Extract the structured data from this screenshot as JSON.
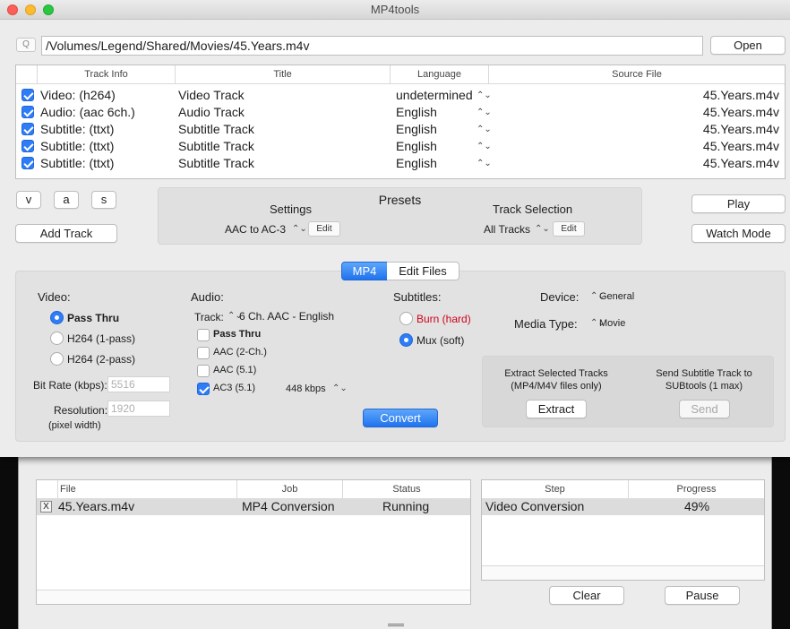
{
  "window": {
    "title": "MP4tools"
  },
  "colors": {
    "accent": "#2e7cf6",
    "burn_red": "#d0021b"
  },
  "file_bar": {
    "search_icon": "Q",
    "path": "/Volumes/Legend/Shared/Movies/45.Years.m4v",
    "open_label": "Open"
  },
  "tracks_table": {
    "headers": [
      "Track Info",
      "Title",
      "Language",
      "Source File"
    ],
    "rows": [
      {
        "checked": true,
        "info": "Video: (h264)",
        "title": "Video Track",
        "language": "undetermined",
        "source": "45.Years.m4v"
      },
      {
        "checked": true,
        "info": "Audio: (aac 6ch.)",
        "title": "Audio Track",
        "language": "English",
        "source": "45.Years.m4v"
      },
      {
        "checked": true,
        "info": "Subtitle: (ttxt)",
        "title": "Subtitle Track",
        "language": "English",
        "source": "45.Years.m4v"
      },
      {
        "checked": true,
        "info": "Subtitle: (ttxt)",
        "title": "Subtitle Track",
        "language": "English",
        "source": "45.Years.m4v"
      },
      {
        "checked": true,
        "info": "Subtitle: (ttxt)",
        "title": "Subtitle Track",
        "language": "English",
        "source": "45.Years.m4v"
      }
    ]
  },
  "track_buttons": {
    "v": "v",
    "a": "a",
    "s": "s",
    "add_track": "Add Track"
  },
  "presets": {
    "title": "Presets",
    "settings_label": "Settings",
    "settings_value": "AAC to AC-3",
    "track_selection_label": "Track Selection",
    "track_selection_value": "All Tracks",
    "edit_label": "Edit"
  },
  "play_label": "Play",
  "watch_mode_label": "Watch Mode",
  "tabs": {
    "mp4": "MP4",
    "edit_files": "Edit Files"
  },
  "video": {
    "label": "Video:",
    "options": [
      "Pass Thru",
      "H264 (1-pass)",
      "H264 (2-pass)"
    ],
    "selected": 0,
    "bitrate_label": "Bit Rate (kbps):",
    "bitrate_placeholder": "5516",
    "resolution_label": "Resolution:",
    "resolution_placeholder": "1920",
    "pixel_width_label": "(pixel width)"
  },
  "audio": {
    "label": "Audio:",
    "track_label": "Track:",
    "track_value": "6 Ch. AAC - English",
    "options": [
      {
        "label": "Pass Thru",
        "checked": false
      },
      {
        "label": "AAC (2-Ch.)",
        "checked": false
      },
      {
        "label": "AAC (5.1)",
        "checked": false
      },
      {
        "label": "AC3 (5.1)",
        "checked": true
      }
    ],
    "bitrate": "448 kbps"
  },
  "subtitles": {
    "label": "Subtitles:",
    "burn": "Burn (hard)",
    "mux": "Mux (soft)"
  },
  "device": {
    "label": "Device:",
    "value": "General",
    "media_type_label": "Media Type:",
    "media_type_value": "Movie"
  },
  "extract": {
    "text_line1": "Extract Selected Tracks",
    "text_line2": "(MP4/M4V files only)",
    "button": "Extract",
    "send_line1": "Send Subtitle Track to",
    "send_line2": "SUBtools (1 max)",
    "send_button": "Send"
  },
  "convert_label": "Convert",
  "queue": {
    "headers": [
      "File",
      "Job",
      "Status"
    ],
    "rows": [
      {
        "remove": "X",
        "file": "45.Years.m4v",
        "job": "MP4 Conversion",
        "status": "Running"
      }
    ]
  },
  "progress": {
    "headers": [
      "Step",
      "Progress"
    ],
    "rows": [
      {
        "step": "Video Conversion",
        "progress": "49%"
      }
    ]
  },
  "clear_label": "Clear",
  "pause_label": "Pause"
}
